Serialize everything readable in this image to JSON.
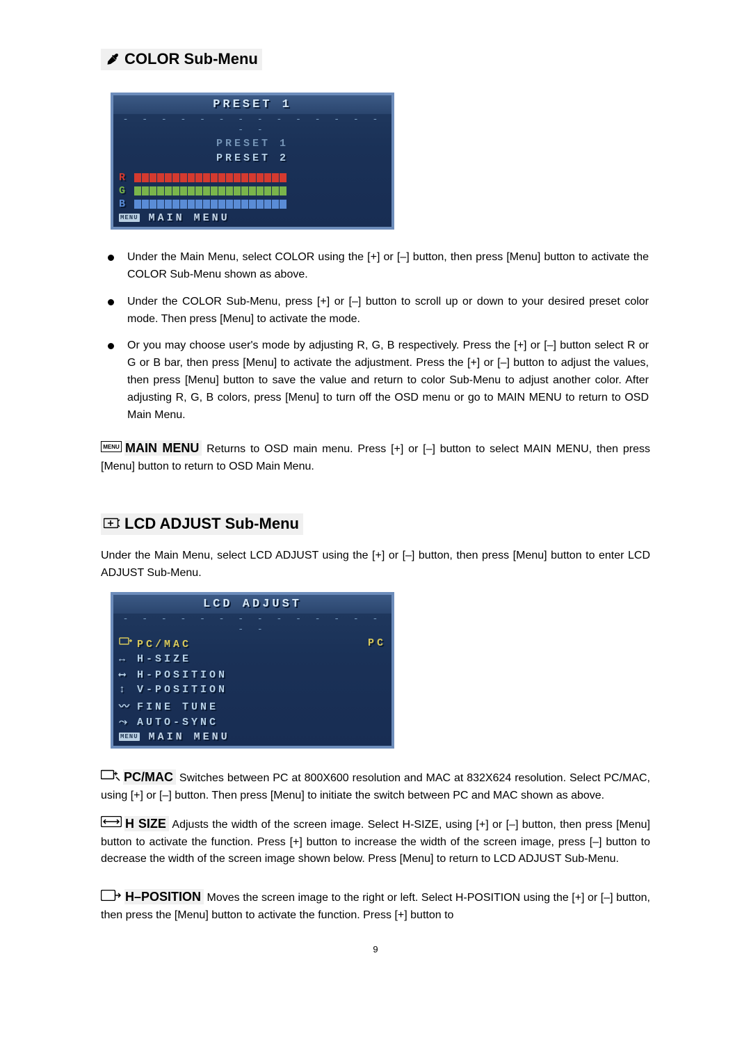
{
  "headings": {
    "color_submenu": "COLOR Sub-Menu",
    "lcd_adjust_submenu": "LCD ADJUST Sub-Menu"
  },
  "osd1": {
    "title": "PRESET  1",
    "preset1": "PRESET  1",
    "preset2": "PRESET  2",
    "r": "R",
    "g": "G",
    "b": "B",
    "main_menu": "MAIN  MENU",
    "menu_icon": "MENU"
  },
  "bullets": {
    "b1": "Under the Main Menu, select COLOR using the [+] or [–] button, then press [Menu] button to activate the COLOR Sub-Menu shown as above.",
    "b2": "Under the COLOR Sub-Menu, press [+] or [–] button to scroll up or down to your desired preset color mode. Then press [Menu] to activate the mode.",
    "b3": "Or you may choose user's mode by adjusting R, G, B respectively. Press the [+] or [–] button select R or G or B bar, then press [Menu] to activate the adjustment. Press the [+] or [–] button to adjust the values, then press [Menu] button to save the value and return to color Sub-Menu to adjust another color. After adjusting R, G, B colors, press [Menu] to turn off the OSD menu or go to MAIN MENU to return to OSD Main Menu."
  },
  "paras": {
    "main_menu_label": "MAIN MENU",
    "main_menu_text": " Returns to OSD main menu. Press [+] or [–] button to select MAIN MENU, then press [Menu] button to return to OSD Main Menu.",
    "lcd_intro": "Under the Main Menu, select LCD ADJUST using the [+] or [–] button, then press [Menu] button to enter LCD ADJUST Sub-Menu.",
    "pcmac_label": "PC/MAC",
    "pcmac_text": " Switches between PC at 800X600 resolution and MAC at 832X624 resolution. Select PC/MAC, using [+] or [–] button. Then press [Menu] to initiate the switch between PC and MAC shown as above.",
    "hsize_label": "H SIZE",
    "hsize_text": " Adjusts the width of the screen image. Select H-SIZE, using [+] or [–] button, then press [Menu] button to activate the function. Press [+] button to increase the width of the screen image, press [–] button to decrease the width of the screen image shown below. Press [Menu] to return to LCD ADJUST Sub-Menu.",
    "hpos_label": "H–POSITION",
    "hpos_text": " Moves the screen image to the right or left. Select H-POSITION using the [+] or [–] button, then press the [Menu] button to activate the function. Press [+] button to"
  },
  "osd2": {
    "title": "LCD  ADJUST",
    "pcmac": "PC/MAC",
    "pcmac_val": "PC",
    "hsize": "H-SIZE",
    "hpos": "H-POSITION",
    "vpos": "V-POSITION",
    "fine": "FINE  TUNE",
    "auto": "AUTO-SYNC",
    "main_menu": "MAIN  MENU",
    "menu_icon": "MENU"
  },
  "page_number": "9"
}
